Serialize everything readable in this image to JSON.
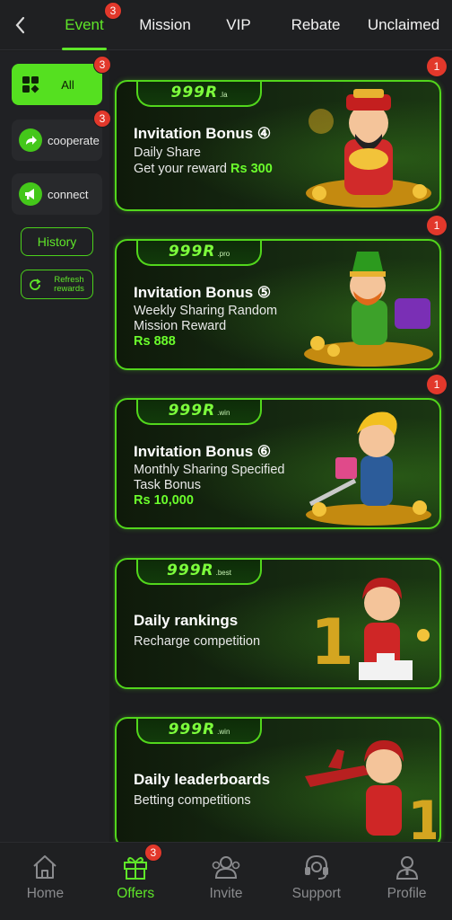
{
  "topbar": {
    "tabs": [
      {
        "label": "Event",
        "badge": "3"
      },
      {
        "label": "Mission"
      },
      {
        "label": "VIP"
      },
      {
        "label": "Rebate"
      },
      {
        "label": "Unclaimed"
      }
    ]
  },
  "sidebar": {
    "all": {
      "label": "All",
      "badge": "3"
    },
    "cooperate": {
      "label": "cooperate",
      "badge": "3"
    },
    "connect": {
      "label": "connect"
    },
    "history": "History",
    "refresh": "Refresh rewards"
  },
  "cards": [
    {
      "logo": "999R",
      "logo_sub": ".la",
      "badge": "1",
      "title": "Invitation Bonus ④",
      "line1": "Daily Share",
      "line2": "Get your reward ",
      "amount": "Rs 300"
    },
    {
      "logo": "999R",
      "logo_sub": ".pro",
      "badge": "1",
      "title": "Invitation Bonus ⑤",
      "line1": "Weekly Sharing Random",
      "line2": "Mission Reward",
      "amount": "Rs 888"
    },
    {
      "logo": "999R",
      "logo_sub": ".win",
      "badge": "1",
      "title": "Invitation Bonus ⑥",
      "line1": "Monthly Sharing Specified",
      "line2": "Task Bonus",
      "amount": "Rs 10,000"
    },
    {
      "logo": "999R",
      "logo_sub": ".best",
      "title": "Daily rankings",
      "line1": "Recharge competition"
    },
    {
      "logo": "999R",
      "logo_sub": ".win",
      "title": "Daily leaderboards",
      "line1": "Betting competitions"
    }
  ],
  "bottomnav": [
    {
      "label": "Home",
      "icon": "home-icon"
    },
    {
      "label": "Offers",
      "icon": "gift-icon",
      "badge": "3"
    },
    {
      "label": "Invite",
      "icon": "invite-icon"
    },
    {
      "label": "Support",
      "icon": "headset-icon"
    },
    {
      "label": "Profile",
      "icon": "profile-icon"
    }
  ],
  "colors": {
    "accent": "#5fe629",
    "badge": "#e2382b",
    "background": "#1c1d1f"
  }
}
